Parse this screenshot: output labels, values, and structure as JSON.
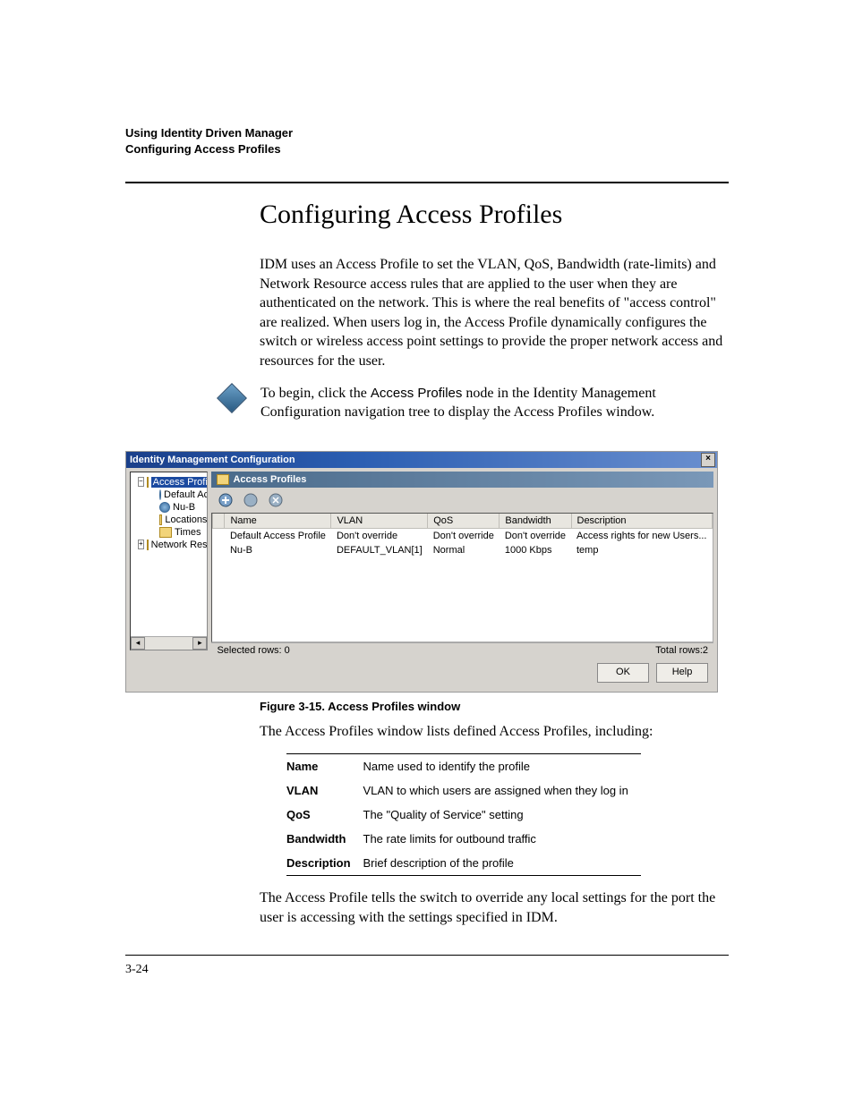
{
  "running_header": {
    "line1": "Using Identity Driven Manager",
    "line2": "Configuring Access Profiles"
  },
  "title": "Configuring Access Profiles",
  "para1": "IDM uses an Access Profile to set the VLAN, QoS, Bandwidth (rate-limits) and Network Resource access rules that are applied to the user when they are authenticated on the network. This is where the real benefits of \"access control\" are realized. When users log in, the Access Profile dynamically configures the switch or wireless access point settings to provide the proper network access and resources for the user.",
  "begin_para_pre": "To begin, click the ",
  "begin_para_bold": "Access Profiles",
  "begin_para_post": " node in the Identity Management Configuration navigation tree to display the Access Profiles window.",
  "window": {
    "title": "Identity Management Configuration",
    "tree": {
      "root": "Access Profiles",
      "items": [
        "Default Access Pro",
        "Nu-B",
        "Locations",
        "Times",
        "Network Resources"
      ]
    },
    "panel_title": "Access Profiles",
    "columns": [
      "Name",
      "VLAN",
      "QoS",
      "Bandwidth",
      "Description"
    ],
    "rows": [
      {
        "name": "Default Access Profile",
        "vlan": "Don't override",
        "qos": "Don't override",
        "bw": "Don't override",
        "desc": "Access rights for new Users..."
      },
      {
        "name": "Nu-B",
        "vlan": "DEFAULT_VLAN[1]",
        "qos": "Normal",
        "bw": "1000 Kbps",
        "desc": "temp"
      }
    ],
    "selected_rows": "Selected rows: 0",
    "total_rows": "Total rows:2",
    "ok": "OK",
    "help": "Help"
  },
  "figure_caption": "Figure 3-15. Access Profiles window",
  "after_fig": "The Access Profiles window lists defined Access Profiles, including:",
  "defs": [
    {
      "label": "Name",
      "text": "Name used to identify the profile"
    },
    {
      "label": "VLAN",
      "text": "VLAN to which users are assigned when they log in"
    },
    {
      "label": "QoS",
      "text": "The \"Quality of Service\" setting"
    },
    {
      "label": "Bandwidth",
      "text": "The rate limits for outbound traffic"
    },
    {
      "label": "Description",
      "text": "Brief description of the profile"
    }
  ],
  "closing": "The Access Profile tells the switch to override any local settings for the port the user is accessing with the settings specified in IDM.",
  "page_number": "3-24"
}
